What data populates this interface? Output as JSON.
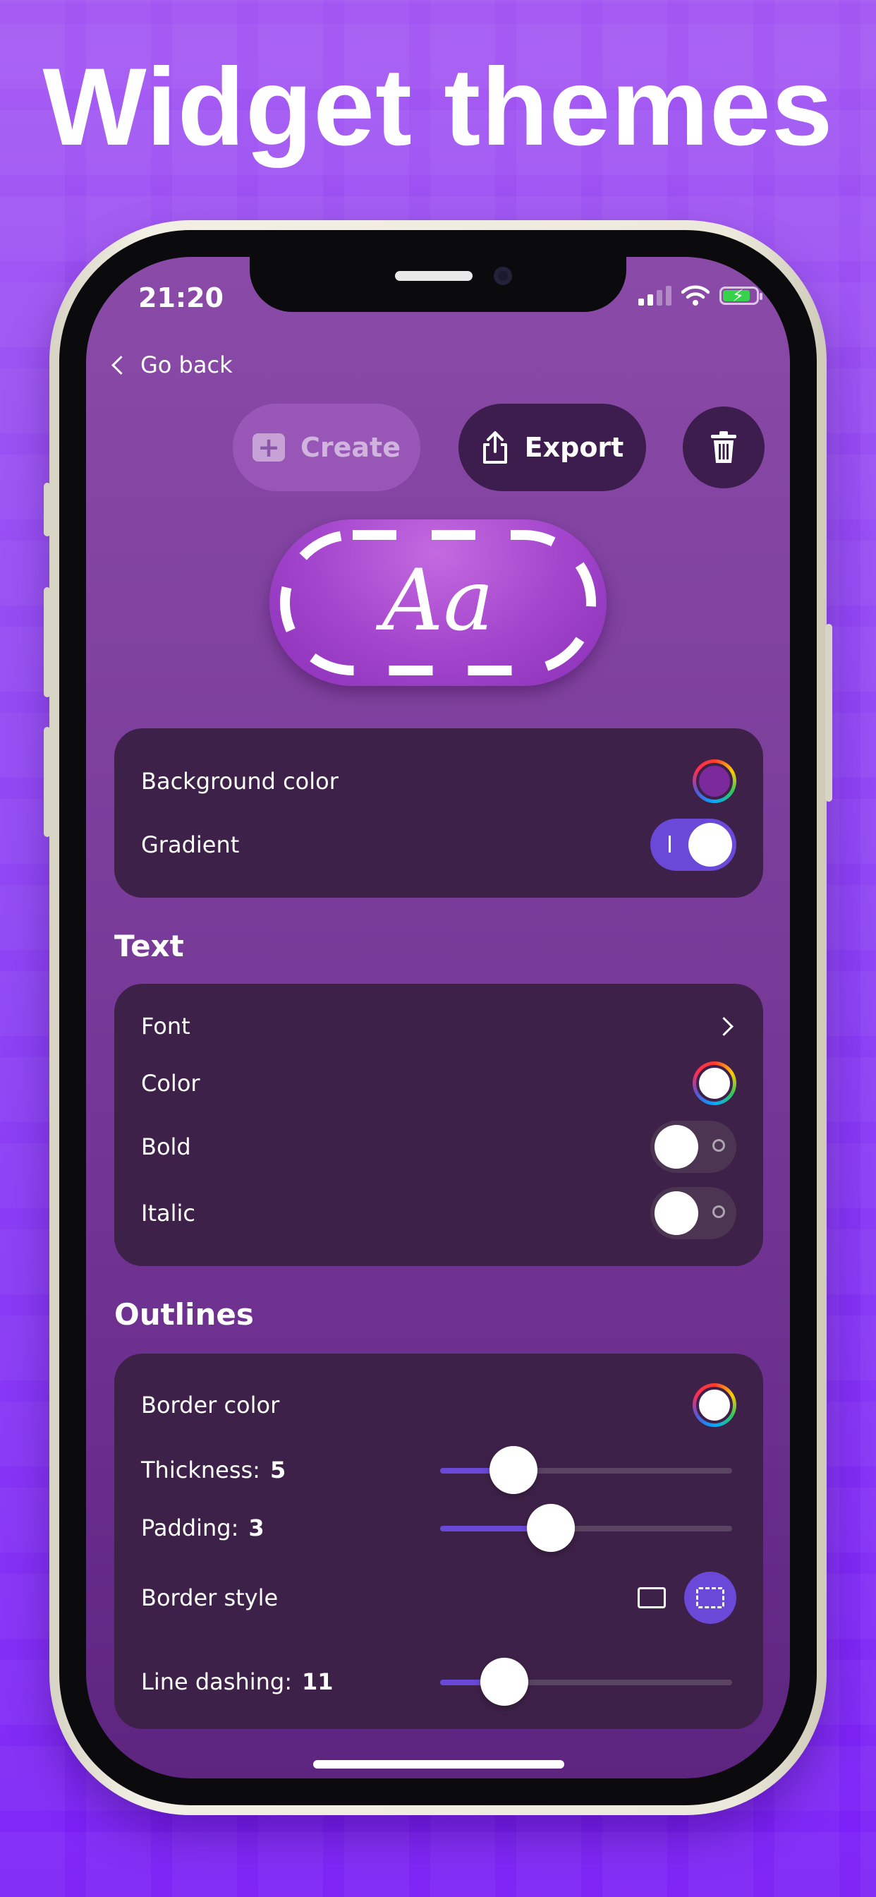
{
  "headline": "Widget themes",
  "status_bar": {
    "time": "21:20",
    "icons": [
      "cellular-signal-icon",
      "wifi-icon",
      "battery-charging-icon"
    ]
  },
  "nav": {
    "back_label": "Go back"
  },
  "actions": {
    "create_label": "Create",
    "export_label": "Export",
    "delete_icon": "trash-icon"
  },
  "preview": {
    "text": "Aa"
  },
  "background": {
    "color_label": "Background color",
    "color": "#7a2a9a",
    "gradient_label": "Gradient",
    "gradient_on": true
  },
  "text_section": {
    "title": "Text",
    "font_label": "Font",
    "color_label": "Color",
    "color": "#ffffff",
    "bold_label": "Bold",
    "bold_on": false,
    "italic_label": "Italic",
    "italic_on": false
  },
  "outlines": {
    "title": "Outlines",
    "border_color_label": "Border color",
    "border_color": "#ffffff",
    "thickness_label": "Thickness:",
    "thickness_value": "5",
    "thickness_fraction": 0.25,
    "padding_label": "Padding:",
    "padding_value": "3",
    "padding_fraction": 0.38,
    "border_style_label": "Border style",
    "border_style_options": [
      "solid",
      "dashed"
    ],
    "border_style_selected": "dashed",
    "line_dashing_label": "Line dashing:",
    "line_dashing_value": "11",
    "line_dashing_fraction": 0.22
  },
  "colors": {
    "accent": "#6a48d8",
    "card": "#3e2148",
    "button_dark": "#3d1d4d"
  }
}
